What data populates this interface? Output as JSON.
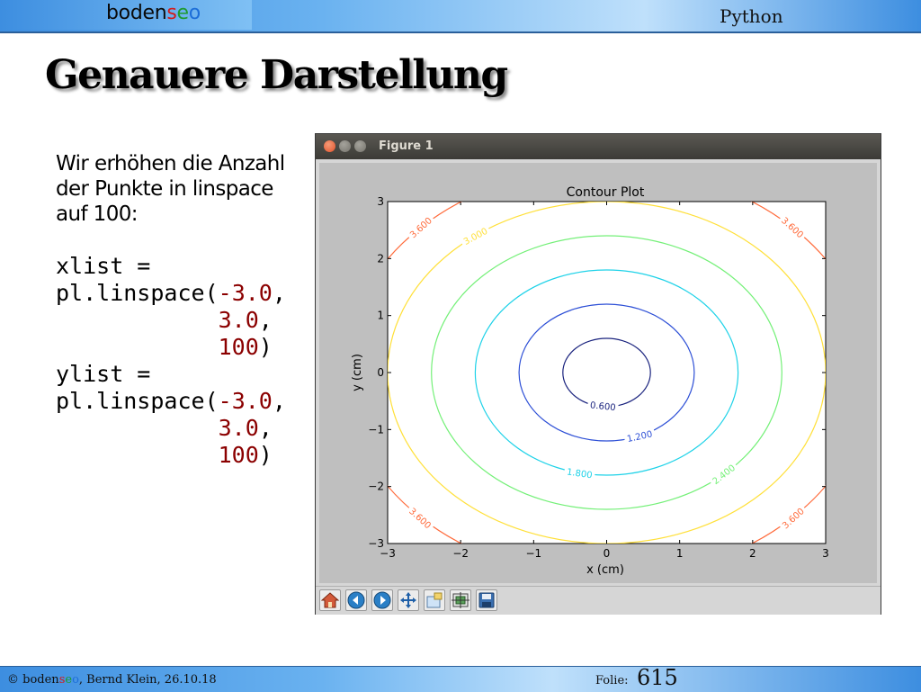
{
  "header": {
    "logo": {
      "part1": "boden",
      "s": "s",
      "e": "e",
      "o": "o"
    },
    "right": "Python"
  },
  "slide": {
    "title": "Genauere Darstellung",
    "intro_lines": [
      "Wir erhöhen die Anzahl",
      "der Punkte in linspace",
      "auf 100:"
    ],
    "code": {
      "x_var": "xlist =",
      "y_var": "ylist =",
      "call": "pl.linspace(",
      "neg": "-",
      "start": "3.0",
      "stop": "3.0",
      "count": "100",
      "comma": ",",
      "close": ")"
    }
  },
  "window": {
    "title": "Figure 1",
    "toolbar": [
      "home-icon",
      "back-icon",
      "forward-icon",
      "pan-icon",
      "zoom-icon",
      "configure-subplots-icon",
      "save-icon"
    ]
  },
  "chart_data": {
    "type": "contour",
    "title": "Contour Plot",
    "xlabel": "x (cm)",
    "ylabel": "y (cm)",
    "xlim": [
      -3,
      3
    ],
    "ylim": [
      -3,
      3
    ],
    "xticks": [
      "−3",
      "−2",
      "−1",
      "0",
      "1",
      "2",
      "3"
    ],
    "yticks": [
      "−3",
      "−2",
      "−1",
      "0",
      "1",
      "2",
      "3"
    ],
    "function": "sqrt(x^2 + y^2)",
    "levels": [
      {
        "value": 0.6,
        "label": "0.600",
        "color": "#1a237e"
      },
      {
        "value": 1.2,
        "label": "1.200",
        "color": "#2d4fd6"
      },
      {
        "value": 1.8,
        "label": "1.800",
        "color": "#1ed2e8"
      },
      {
        "value": 2.4,
        "label": "2.400",
        "color": "#74f078"
      },
      {
        "value": 3.0,
        "label": "3.000",
        "color": "#ffe03a"
      },
      {
        "value": 3.6,
        "label": "3.600",
        "color": "#ff6a3a"
      }
    ],
    "label_positions": [
      {
        "level": 0,
        "x": -0.05,
        "y": -0.58,
        "rot": 6
      },
      {
        "level": 1,
        "x": 0.45,
        "y": -1.11,
        "rot": -12
      },
      {
        "level": 2,
        "x": -0.37,
        "y": -1.76,
        "rot": 8
      },
      {
        "level": 3,
        "x": 1.6,
        "y": -1.78,
        "rot": -38
      },
      {
        "level": 4,
        "x": -1.8,
        "y": 2.4,
        "rot": -28
      },
      {
        "level": 5,
        "x": -2.55,
        "y": 2.55,
        "rot": -42
      },
      {
        "level": 5,
        "x": 2.55,
        "y": 2.55,
        "rot": 42
      },
      {
        "level": 5,
        "x": -2.55,
        "y": -2.55,
        "rot": 42
      },
      {
        "level": 5,
        "x": 2.55,
        "y": -2.55,
        "rot": -42
      }
    ]
  },
  "footer": {
    "copyright": "©",
    "logo": {
      "part1": "boden",
      "s": "s",
      "e": "e",
      "o": "o"
    },
    "rest": ", Bernd Klein, 26.10.18",
    "folie_label": "Folie:",
    "folie_number": "615"
  }
}
